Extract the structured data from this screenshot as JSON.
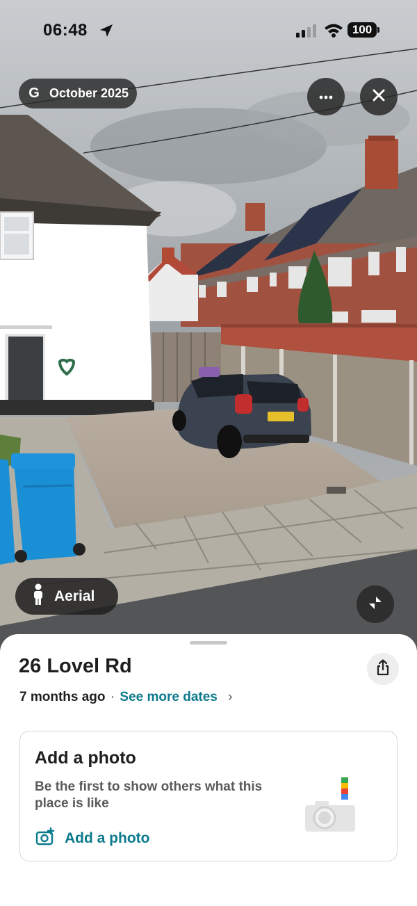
{
  "status_bar": {
    "time": "06:48",
    "battery": "100"
  },
  "viewer": {
    "capture_date": "October 2025",
    "google_letter": "G",
    "more_icon": "ellipsis-icon",
    "close_icon": "close-icon",
    "aerial_label": "Aerial",
    "collapse_icon": "collapse-arrows-icon"
  },
  "sheet": {
    "title": "26 Lovel Rd",
    "age": "7 months ago",
    "separator": "·",
    "see_more": "See more dates",
    "chevron": "›",
    "card": {
      "title": "Add a photo",
      "description": "Be the first to show others what this place is like",
      "link": "Add a photo"
    }
  },
  "colors": {
    "accent": "#0b7a8c",
    "pill_bg": "#282828",
    "sheet_bg": "#ffffff"
  }
}
